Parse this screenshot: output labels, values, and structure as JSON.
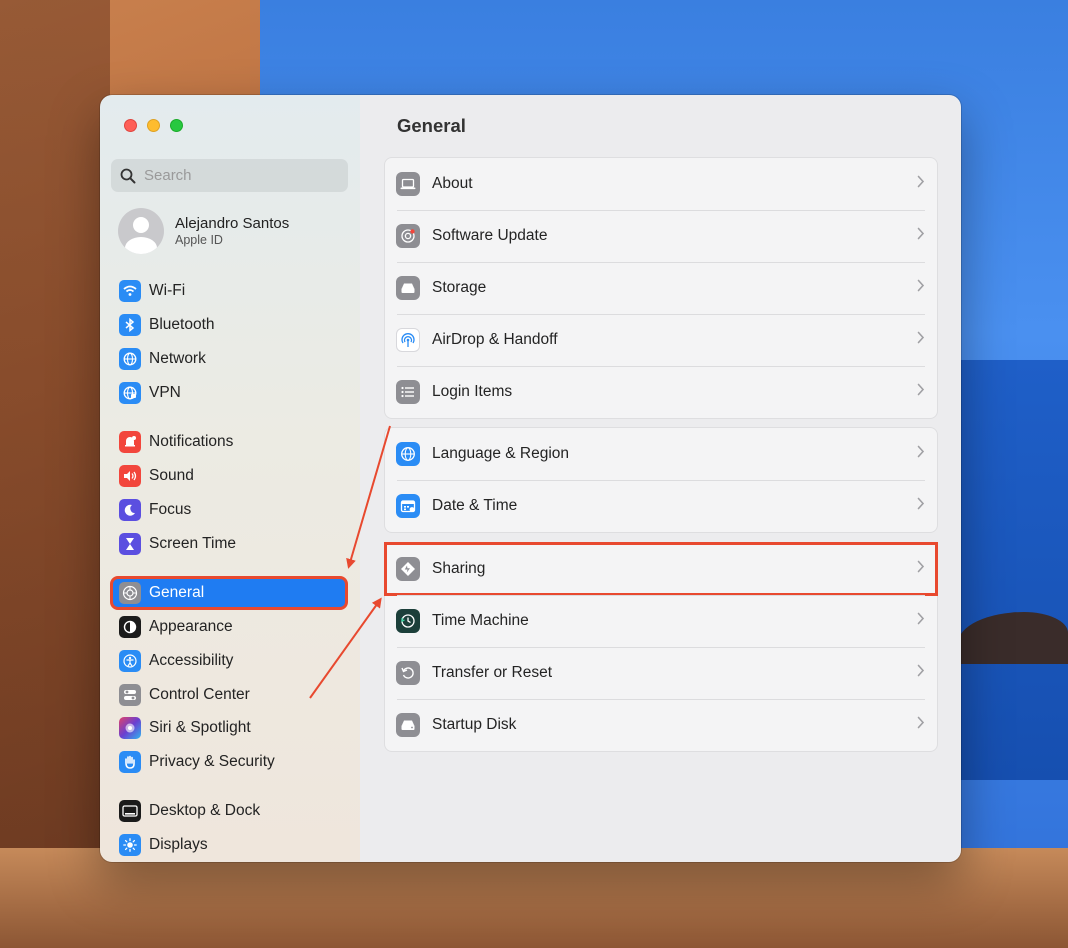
{
  "window": {
    "traffic_lights": [
      "close",
      "minimize",
      "zoom"
    ]
  },
  "sidebar": {
    "search": {
      "placeholder": "Search",
      "value": ""
    },
    "account": {
      "name": "Alejandro Santos",
      "subtitle": "Apple ID"
    },
    "items": [
      {
        "label": "Wi-Fi",
        "icon": "wifi-icon",
        "color": "#2a8cf5"
      },
      {
        "label": "Bluetooth",
        "icon": "bluetooth-icon",
        "color": "#2a8cf5"
      },
      {
        "label": "Network",
        "icon": "globe-icon",
        "color": "#2a8cf5"
      },
      {
        "label": "VPN",
        "icon": "vpn-globe-icon",
        "color": "#2a8cf5"
      },
      {
        "label": "Notifications",
        "icon": "bell-icon",
        "color": "#f2463c"
      },
      {
        "label": "Sound",
        "icon": "speaker-icon",
        "color": "#f2463c"
      },
      {
        "label": "Focus",
        "icon": "moon-icon",
        "color": "#5b4fe0"
      },
      {
        "label": "Screen Time",
        "icon": "hourglass-icon",
        "color": "#5b4fe0"
      },
      {
        "label": "General",
        "icon": "gear-icon",
        "color": "#8e8e93",
        "selected": true
      },
      {
        "label": "Appearance",
        "icon": "appearance-icon",
        "color": "#1b1b1b"
      },
      {
        "label": "Accessibility",
        "icon": "accessibility-icon",
        "color": "#2a8cf5"
      },
      {
        "label": "Control Center",
        "icon": "toggles-icon",
        "color": "#8e8e93"
      },
      {
        "label": "Siri & Spotlight",
        "icon": "siri-icon",
        "color": "#6a3fd0"
      },
      {
        "label": "Privacy & Security",
        "icon": "hand-icon",
        "color": "#2a8cf5"
      },
      {
        "label": "Desktop & Dock",
        "icon": "dock-icon",
        "color": "#1b1b1b"
      },
      {
        "label": "Displays",
        "icon": "sun-icon",
        "color": "#2a8cf5"
      }
    ]
  },
  "main": {
    "title": "General",
    "groups": [
      [
        {
          "label": "About",
          "icon": "laptop-icon"
        },
        {
          "label": "Software Update",
          "icon": "gear-badge-icon"
        },
        {
          "label": "Storage",
          "icon": "drive-icon"
        },
        {
          "label": "AirDrop & Handoff",
          "icon": "airdrop-icon"
        },
        {
          "label": "Login Items",
          "icon": "list-icon"
        }
      ],
      [
        {
          "label": "Language & Region",
          "icon": "globe-icon"
        },
        {
          "label": "Date & Time",
          "icon": "calendar-icon"
        }
      ],
      [
        {
          "label": "Sharing",
          "icon": "sharing-icon",
          "highlighted": true
        },
        {
          "label": "Time Machine",
          "icon": "time-machine-icon"
        },
        {
          "label": "Transfer or Reset",
          "icon": "reset-icon"
        },
        {
          "label": "Startup Disk",
          "icon": "startup-disk-icon"
        }
      ]
    ]
  },
  "colors": {
    "accent": "#1f7cf2",
    "annotation": "#e8492f"
  }
}
